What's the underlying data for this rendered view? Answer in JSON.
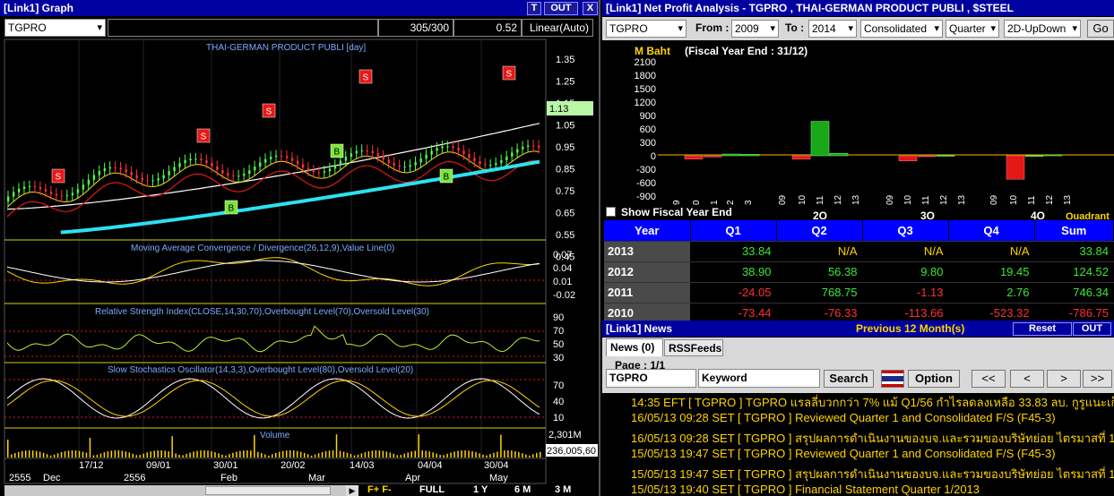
{
  "graph": {
    "title": "[Link1] Graph",
    "buttons": {
      "t": "T",
      "out": "OUT",
      "close": "X"
    },
    "symbol": "TGPRO",
    "counter": "305/300",
    "price_readout": "0.52",
    "scale_mode": "Linear(Auto)",
    "chart_title": "THAI-GERMAN PRODUCT PUBLI [day]",
    "last_price": "1.13",
    "price_ticks": [
      "1.35",
      "1.25",
      "1.15",
      "1.05",
      "0.95",
      "0.85",
      "0.75",
      "0.65",
      "0.55",
      "0.45"
    ],
    "macd_title": "Moving Average Convergence / Divergence(26,12,9),Value Line(0)",
    "macd_ticks": [
      "0.07",
      "0.04",
      "0.01",
      "-0.02"
    ],
    "rsi_title": "Relative Strength Index(CLOSE,14,30,70),Overbought Level(70),Oversold Level(30)",
    "rsi_ticks": [
      "90",
      "70",
      "50",
      "30"
    ],
    "stoch_title": "Slow Stochastics Oscillator(14,3,3),Overbought Level(80),Oversold Level(20)",
    "stoch_ticks": [
      "70",
      "40",
      "10"
    ],
    "volume_title": "Volume",
    "volume_max": "2,301M",
    "volume_last": "236,005,60",
    "date_labels_top": [
      "17/12",
      "09/01",
      "30/01",
      "20/02",
      "14/03",
      "04/04",
      "30/04"
    ],
    "date_labels_bottom": [
      "2555",
      "Dec",
      "2556",
      "Feb",
      "Mar",
      "Apr",
      "May"
    ],
    "signals": {
      "sell": "S",
      "buy": "B"
    },
    "period_buttons": [
      "FULL",
      "1 Y",
      "6 M",
      "3 M"
    ]
  },
  "netprofit": {
    "title": "[Link1] Net Profit Analysis - TGPRO , THAI-GERMAN PRODUCT PUBLI , $STEEL",
    "symbol": "TGPRO",
    "from_label": "From :",
    "from_year": "2009",
    "to_label": "To :",
    "to_year": "2014",
    "mode": "Consolidated",
    "period": "Quarter",
    "chart_style": "2D-UpDown",
    "go": "Go",
    "unit": "M Baht",
    "fiscal_note": "(Fiscal Year End : 31/12)",
    "y_ticks": [
      "2100",
      "1800",
      "1500",
      "1200",
      "900",
      "600",
      "300",
      "0",
      "-300",
      "-600",
      "-900"
    ],
    "show_fye": "Show Fiscal Year End",
    "x_year_labels": [
      "9",
      "0",
      "1",
      "2",
      "3",
      "09",
      "10",
      "11",
      "12",
      "13",
      "09",
      "10",
      "11",
      "12",
      "13",
      "09",
      "10",
      "11",
      "12",
      "13"
    ],
    "quarter_labels": [
      "2Q",
      "3Q",
      "4Q"
    ],
    "quadrant_label": "Quadrant",
    "chart_data": {
      "type": "bar",
      "ylabel": "M Baht",
      "ylim": [
        -900,
        2100
      ],
      "categories": [
        "Q1",
        "Q2",
        "Q3",
        "Q4"
      ],
      "series": [
        {
          "name": "2010",
          "values": [
            -73.44,
            -76.33,
            -113.66,
            -523.32
          ]
        },
        {
          "name": "2011",
          "values": [
            -24.05,
            768.75,
            -1.13,
            2.76
          ]
        },
        {
          "name": "2012",
          "values": [
            38.9,
            56.38,
            9.8,
            19.45
          ]
        },
        {
          "name": "2013",
          "values": [
            33.84,
            null,
            null,
            null
          ]
        }
      ]
    },
    "table": {
      "headers": [
        "Year",
        "Q1",
        "Q2",
        "Q3",
        "Q4",
        "Sum"
      ],
      "rows": [
        [
          "2013",
          "33.84",
          "N/A",
          "N/A",
          "N/A",
          "33.84"
        ],
        [
          "2012",
          "38.90",
          "56.38",
          "9.80",
          "19.45",
          "124.52"
        ],
        [
          "2011",
          "-24.05",
          "768.75",
          "-1.13",
          "2.76",
          "746.34"
        ],
        [
          "2010",
          "-73.44",
          "-76.33",
          "-113.66",
          "-523.32",
          "-786.75"
        ]
      ]
    }
  },
  "news": {
    "title": "[Link1] News",
    "prev_label": "Previous 12 Month(s)",
    "reset": "Reset",
    "out": "OUT",
    "tabs": [
      "News (0)",
      "RSSFeeds"
    ],
    "page": "Page : 1/1",
    "symbol": "TGPRO",
    "keyword_label": "Keyword",
    "search": "Search",
    "option": "Option",
    "nav": [
      "<<",
      "<",
      ">",
      ">>"
    ],
    "items": [
      "14:35  EFT  [ TGPRO ]  TGPRO แรลลี่บวกกว่า 7% แม้ Q1/56 กำไรลดลงเหลือ 33.83 ลบ. กูรูแนะเก็ง...",
      "16/05/13 09:28  SET  [ TGPRO ]  Reviewed Quarter 1 and Consolidated F/S (F45-3)",
      "16/05/13 09:28  SET  [ TGPRO ]  สรุปผลการดำเนินงานของบจ.และรวมของบริษัทย่อย ไตรมาสที่ 1 (F...",
      "15/05/13 19:47  SET  [ TGPRO ]  Reviewed Quarter 1 and Consolidated F/S (F45-3)",
      "15/05/13 19:47  SET  [ TGPRO ]  สรุปผลการดำเนินงานของบจ.และรวมของบริษัทย่อย ไตรมาสที่ 1 (F...",
      "15/05/13 19:40  SET  [ TGPRO ]  Financial Statement Quarter 1/2013"
    ]
  }
}
